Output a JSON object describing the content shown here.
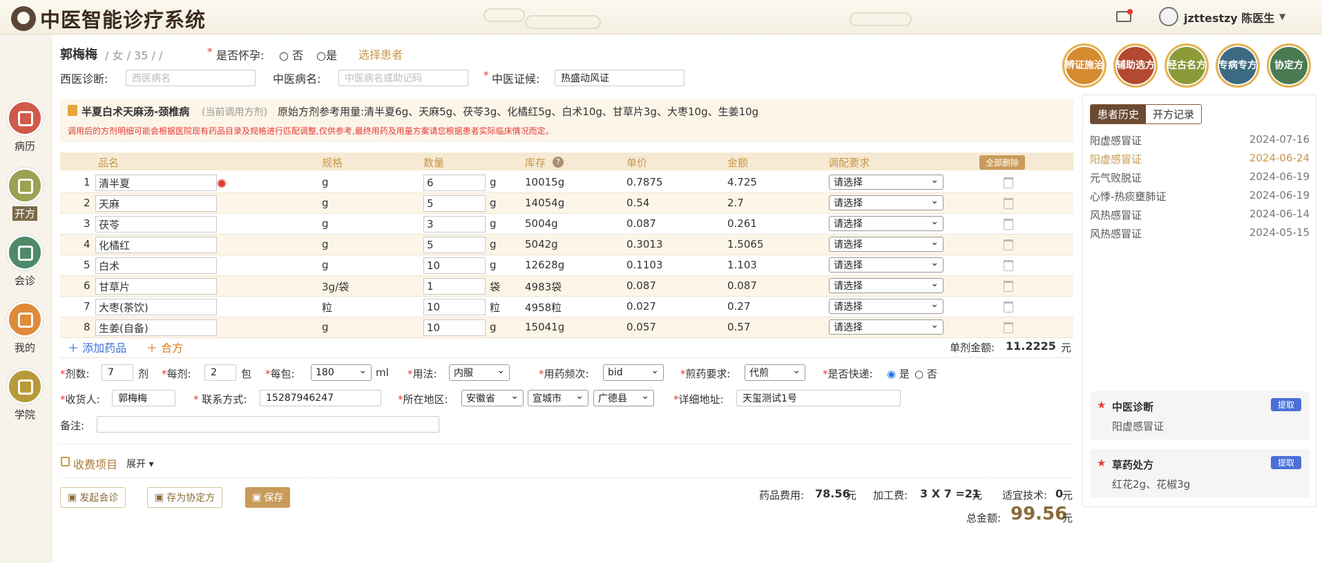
{
  "app": {
    "title": "中医智能诊疗系统",
    "user": "jzttestzy 陈医生"
  },
  "sidebar": [
    {
      "label": "病历"
    },
    {
      "label": "开方"
    },
    {
      "label": "会诊"
    },
    {
      "label": "我的"
    },
    {
      "label": "学院"
    }
  ],
  "patient": {
    "name": "郭梅梅",
    "info": "/ 女 / 35 /      /",
    "pregnant_label": "是否怀孕:",
    "no": "否",
    "yes": "是",
    "select": "选择患者"
  },
  "diag": {
    "west_label": "西医诊断:",
    "west_ph": "西医病名",
    "tcm_label": "中医病名:",
    "tcm_ph": "中医病名或助记码",
    "syndrome_label": "中医证候:",
    "syndrome": "热盛动风证"
  },
  "feature_buttons": [
    "辨证施治",
    "辅助选方",
    "经古名方",
    "专病专方",
    "协定方"
  ],
  "banner": {
    "name": "半夏白术天麻汤-颈椎病",
    "current": "(当前调用方剂)",
    "ref": "原始方剂参考用量:清半夏6g、天麻5g、茯苓3g、化橘红5g、白术10g、甘草片3g、大枣10g、生姜10g",
    "warn": "调用后的方剂明细可能会根据医院现有药品目录及规格进行匹配调整,仅供参考,最终用药及用量方案请您根据患者实际临床情况而定。"
  },
  "table": {
    "headers": [
      "品名",
      "规格",
      "数量",
      "库存",
      "单价",
      "金额",
      "调配要求"
    ],
    "delete_all": "全部删除",
    "rows": [
      {
        "no": "1",
        "name": "清半夏",
        "spec": "g",
        "qty": "6",
        "unit": "g",
        "stock": "10015g",
        "price": "0.7875",
        "amount": "4.725",
        "req": "请选择"
      },
      {
        "no": "2",
        "name": "天麻",
        "spec": "g",
        "qty": "5",
        "unit": "g",
        "stock": "14054g",
        "price": "0.54",
        "amount": "2.7",
        "req": "请选择"
      },
      {
        "no": "3",
        "name": "茯苓",
        "spec": "g",
        "qty": "3",
        "unit": "g",
        "stock": "5004g",
        "price": "0.087",
        "amount": "0.261",
        "req": "请选择"
      },
      {
        "no": "4",
        "name": "化橘红",
        "spec": "g",
        "qty": "5",
        "unit": "g",
        "stock": "5042g",
        "price": "0.3013",
        "amount": "1.5065",
        "req": "请选择"
      },
      {
        "no": "5",
        "name": "白术",
        "spec": "g",
        "qty": "10",
        "unit": "g",
        "stock": "12628g",
        "price": "0.1103",
        "amount": "1.103",
        "req": "请选择"
      },
      {
        "no": "6",
        "name": "甘草片",
        "spec": "3g/袋",
        "qty": "1",
        "unit": "袋",
        "stock": "4983袋",
        "price": "0.087",
        "amount": "0.087",
        "req": "请选择"
      },
      {
        "no": "7",
        "name": "大枣(茶饮)",
        "spec": "粒",
        "qty": "10",
        "unit": "粒",
        "stock": "4958粒",
        "price": "0.027",
        "amount": "0.27",
        "req": "请选择"
      },
      {
        "no": "8",
        "name": "生姜(自备)",
        "spec": "g",
        "qty": "10",
        "unit": "g",
        "stock": "15041g",
        "price": "0.057",
        "amount": "0.57",
        "req": "请选择"
      }
    ],
    "add": "添加药品",
    "combine": "合方",
    "single_label": "单剂金额:",
    "single_value": "11.2225",
    "yuan": "元"
  },
  "form": {
    "doses_label": "剂数:",
    "doses": "7",
    "doses_unit": "剂",
    "per_label": "每剂:",
    "per": "2",
    "per_unit": "包",
    "bag_label": "每包:",
    "bag": "180",
    "bag_unit": "ml",
    "usage_label": "用法:",
    "usage": "内服",
    "freq_label": "用药频次:",
    "freq": "bid",
    "decoct_label": "煎药要求:",
    "decoct": "代煎",
    "express_label": "是否快递:",
    "express_yes": "是",
    "express_no": "否",
    "receiver_label": "收货人:",
    "receiver": "郭梅梅",
    "phone_label": "联系方式:",
    "phone": "15287946247",
    "region_label": "所在地区:",
    "province": "安徽省",
    "city": "宣城市",
    "county": "广德县",
    "addr_label": "详细地址:",
    "addr": "天玺测试1号",
    "remark_label": "备注:"
  },
  "fees": {
    "title": "收费项目",
    "expand": "展开",
    "drug_label": "药品费用:",
    "drug": "78.56",
    "process_label": "加工费:",
    "process": "3 X 7 =21",
    "tech_label": "适宜技术:",
    "tech": "0",
    "total_label": "总金额:",
    "total": "99.56",
    "yuan": "元"
  },
  "actions": {
    "consult": "发起会诊",
    "save_agreement": "存为协定方",
    "save": "保存"
  },
  "right": {
    "tab_history": "患者历史",
    "tab_records": "开方记录",
    "history": [
      {
        "name": "阳虚感冒证",
        "date": "2024-07-16"
      },
      {
        "name": "阳虚感冒证",
        "date": "2024-06-24"
      },
      {
        "name": "元气败脱证",
        "date": "2024-06-19"
      },
      {
        "name": "心悸-热痰壅肺证",
        "date": "2024-06-19"
      },
      {
        "name": "风热感冒证",
        "date": "2024-06-14"
      },
      {
        "name": "风热感冒证",
        "date": "2024-05-15"
      }
    ],
    "diag_title": "中医诊断",
    "diag_value": "阳虚感冒证",
    "herb_title": "草药处方",
    "herb_value": "红花2g、花椒3g",
    "extract": "提取"
  }
}
